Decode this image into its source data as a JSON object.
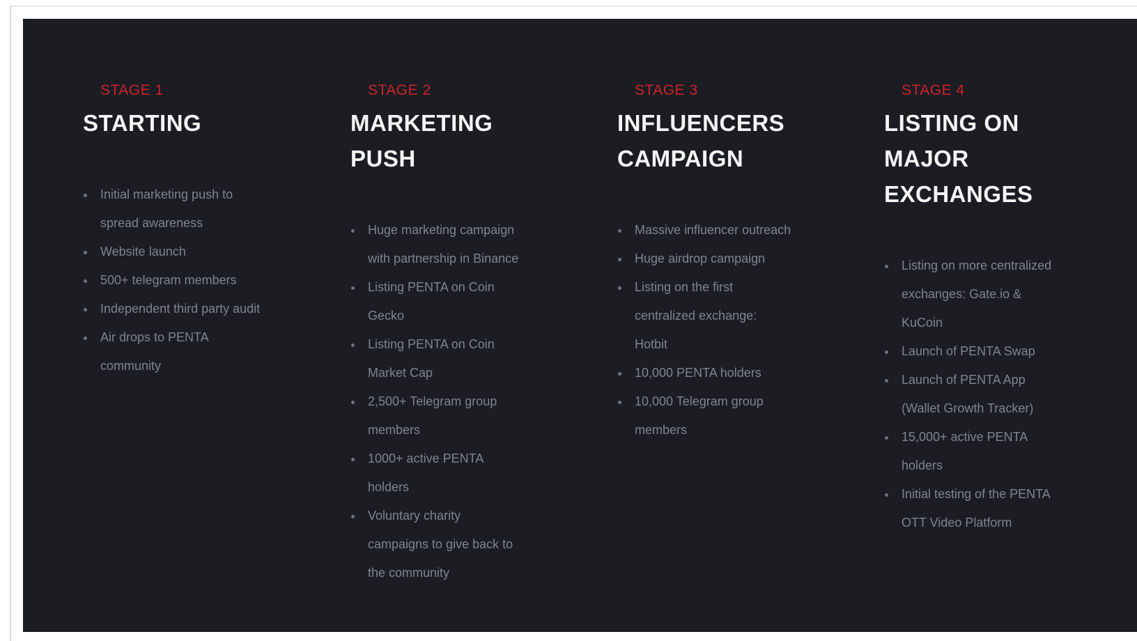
{
  "stages": [
    {
      "label": "STAGE 1",
      "title": "STARTING",
      "items": [
        "Initial marketing push to spread awareness",
        "Website launch",
        "500+ telegram members",
        "Independent third party audit",
        "Air drops to PENTA community"
      ]
    },
    {
      "label": "STAGE 2",
      "title": "MARKETING PUSH",
      "items": [
        "Huge marketing campaign with partnership in Binance",
        "Listing PENTA on Coin Gecko",
        "Listing PENTA on Coin Market Cap",
        "2,500+ Telegram group members",
        "1000+ active PENTA holders",
        "Voluntary charity campaigns to give back to the community"
      ]
    },
    {
      "label": "STAGE 3",
      "title": "INFLUENCERS CAMPAIGN",
      "items": [
        "Massive influencer outreach",
        "Huge airdrop campaign",
        "Listing on the first centralized exchange: Hotbit",
        "10,000 PENTA holders",
        "10,000 Telegram group members"
      ]
    },
    {
      "label": "STAGE 4",
      "title": "LISTING ON MAJOR EXCHANGES",
      "items": [
        "Listing on more centralized exchanges: Gate.io & KuCoin",
        "Launch of PENTA Swap",
        "Launch of PENTA App (Wallet Growth Tracker)",
        "15,000+ active PENTA holders",
        "Initial testing of the PENTA OTT Video Platform"
      ]
    }
  ],
  "colors": {
    "background": "#1b1d22",
    "stage_label": "#d0212b",
    "title": "#f4f4f4",
    "item_text": "#7f848c"
  }
}
